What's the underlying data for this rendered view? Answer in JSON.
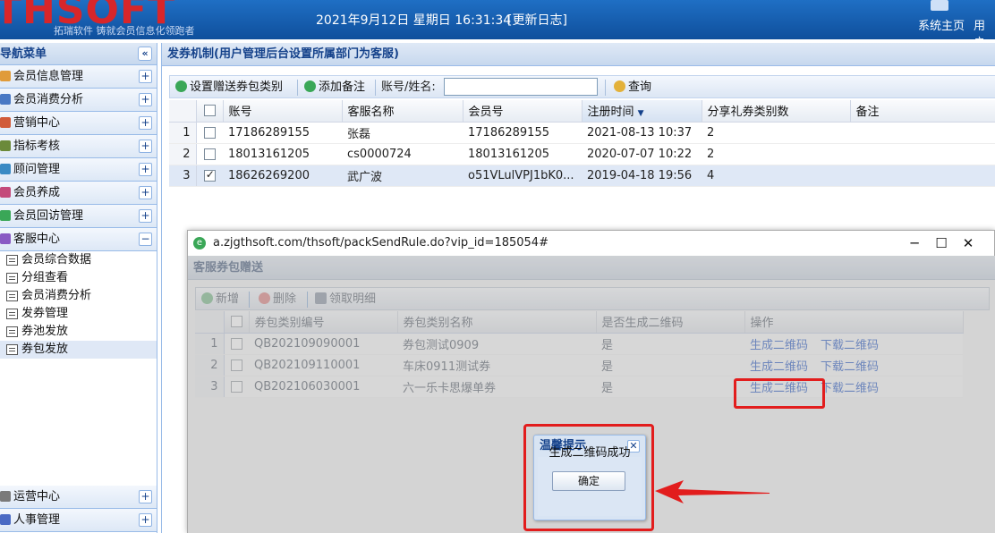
{
  "header": {
    "logo": "THSOFT",
    "logo_sub": "拓瑞软件   铸就会员信息化领跑者",
    "datetime": "2021年9月12日 星期日 16:31:34",
    "changelog_link": "[更新日志]",
    "home_label": "系统主页",
    "user_label": "用户"
  },
  "sidebar": {
    "title": "导航菜单",
    "groups_top": [
      {
        "label": "会员信息管理",
        "icon": "house-icon",
        "color": "#e09b3a",
        "btn": "+"
      },
      {
        "label": "会员消费分析",
        "icon": "chart-icon",
        "color": "#4a79c4",
        "btn": "+"
      },
      {
        "label": "营销中心",
        "icon": "cart-icon",
        "color": "#d15b3a",
        "btn": "+"
      },
      {
        "label": "指标考核",
        "icon": "target-icon",
        "color": "#6b8a3a",
        "btn": "+"
      },
      {
        "label": "顾问管理",
        "icon": "user-icon",
        "color": "#3a8ac4",
        "btn": "+"
      },
      {
        "label": "会员养成",
        "icon": "people-icon",
        "color": "#c44a7a",
        "btn": "+"
      },
      {
        "label": "会员回访管理",
        "icon": "phone-icon",
        "color": "#3aa757",
        "btn": "+"
      },
      {
        "label": "客服中心",
        "icon": "headset-icon",
        "color": "#8a5ac4",
        "btn": "−"
      }
    ],
    "sub_items": [
      {
        "label": "会员综合数据",
        "active": false
      },
      {
        "label": "分组查看",
        "active": false
      },
      {
        "label": "会员消费分析",
        "active": false
      },
      {
        "label": "发券管理",
        "active": false
      },
      {
        "label": "券池发放",
        "active": false
      },
      {
        "label": "券包发放",
        "active": true
      }
    ],
    "groups_bottom": [
      {
        "label": "运营中心",
        "icon": "ops-icon",
        "color": "#7a7a7a",
        "btn": "+"
      },
      {
        "label": "人事管理",
        "icon": "hr-icon",
        "color": "#4a6ac4",
        "btn": "+"
      }
    ]
  },
  "main": {
    "title": "发券机制(用户管理后台设置所属部门为客服)",
    "toolbar": {
      "set_type_label": "设置赠送券包类别",
      "add_note_label": "添加备注",
      "search_label": "账号/姓名:",
      "search_value": "",
      "query_label": "查询"
    },
    "grid": {
      "columns": [
        "账号",
        "客服名称",
        "会员号",
        "注册时间",
        "分享礼券类别数",
        "备注"
      ],
      "rows": [
        {
          "n": "1",
          "checked": false,
          "selected": false,
          "cells": [
            "17186289155",
            "张磊",
            "17186289155",
            "2021-08-13 10:37",
            "2",
            ""
          ]
        },
        {
          "n": "2",
          "checked": false,
          "selected": false,
          "cells": [
            "18013161205",
            "cs0000724",
            "18013161205",
            "2020-07-07 10:22",
            "2",
            ""
          ]
        },
        {
          "n": "3",
          "checked": true,
          "selected": true,
          "cells": [
            "18626269200",
            "武广波",
            "o51VLulVPJ1bK0...",
            "2019-04-18 19:56",
            "4",
            ""
          ]
        }
      ]
    }
  },
  "popup": {
    "url": "a.zjgthsoft.com/thsoft/packSendRule.do?vip_id=185054#",
    "panel_title": "客服券包赠送",
    "toolbar": {
      "add_label": "新增",
      "delete_label": "删除",
      "detail_label": "领取明细"
    },
    "grid": {
      "columns": [
        "券包类别编号",
        "券包类别名称",
        "是否生成二维码",
        "操作"
      ],
      "rows": [
        {
          "n": "1",
          "cells": [
            "QB202109090001",
            "券包测试0909",
            "是"
          ],
          "gen": "生成二维码",
          "dl": "下载二维码"
        },
        {
          "n": "2",
          "cells": [
            "QB202109110001",
            "车床0911测试券",
            "是"
          ],
          "gen": "生成二维码",
          "dl": "下载二维码"
        },
        {
          "n": "3",
          "cells": [
            "QB202106030001",
            "六一乐卡思爆单券",
            "是"
          ],
          "gen": "生成二维码",
          "dl": "下载二维码"
        }
      ]
    }
  },
  "dialog": {
    "title": "温馨提示",
    "message": "生成二维码成功",
    "ok_label": "确定"
  },
  "annotation_color": "#e21d1d"
}
